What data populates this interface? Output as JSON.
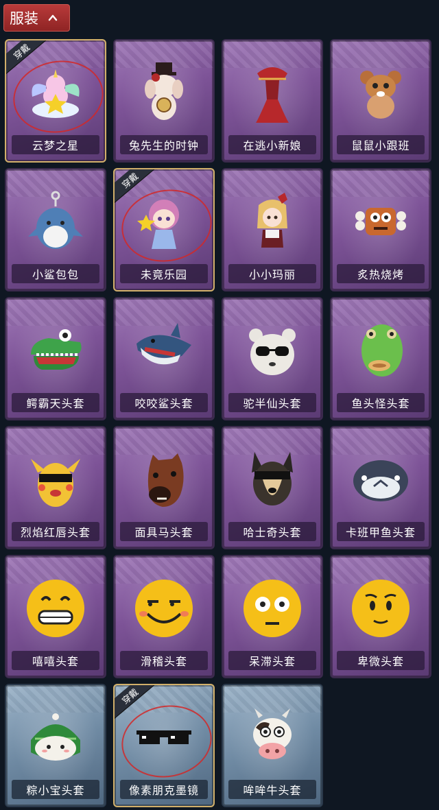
{
  "header": {
    "title": "服装"
  },
  "worn_label": "穿戴",
  "items": [
    {
      "label": "云梦之星",
      "worn": true,
      "bg": "purple",
      "icon": "unicorn-star-icon"
    },
    {
      "label": "兔先生的时钟",
      "worn": false,
      "bg": "purple",
      "icon": "rabbit-clock-icon"
    },
    {
      "label": "在逃小新娘",
      "worn": false,
      "bg": "purple",
      "icon": "bride-dress-icon"
    },
    {
      "label": "鼠鼠小跟班",
      "worn": false,
      "bg": "purple",
      "icon": "mouse-follower-icon"
    },
    {
      "label": "小鲨包包",
      "worn": false,
      "bg": "purple",
      "icon": "shark-bag-icon"
    },
    {
      "label": "未竟乐园",
      "worn": true,
      "bg": "purple",
      "icon": "fairy-girl-icon"
    },
    {
      "label": "小小玛丽",
      "worn": false,
      "bg": "purple",
      "icon": "mary-doll-icon"
    },
    {
      "label": "炙热烧烤",
      "worn": false,
      "bg": "purple",
      "icon": "bbq-meat-icon"
    },
    {
      "label": "鳄霸天头套",
      "worn": false,
      "bg": "purple",
      "icon": "crocodile-head-icon"
    },
    {
      "label": "咬咬鲨头套",
      "worn": false,
      "bg": "purple",
      "icon": "shark-head-icon"
    },
    {
      "label": "驼半仙头套",
      "worn": false,
      "bg": "purple",
      "icon": "panda-head-icon"
    },
    {
      "label": "鱼头怪头套",
      "worn": false,
      "bg": "purple",
      "icon": "fish-head-icon"
    },
    {
      "label": "烈焰红唇头套",
      "worn": false,
      "bg": "purple",
      "icon": "yellow-mascot-head-icon"
    },
    {
      "label": "面具马头套",
      "worn": false,
      "bg": "purple",
      "icon": "horse-head-icon"
    },
    {
      "label": "哈士奇头套",
      "worn": false,
      "bg": "purple",
      "icon": "husky-head-icon"
    },
    {
      "label": "卡班甲鱼头套",
      "worn": false,
      "bg": "purple",
      "icon": "whale-head-icon"
    },
    {
      "label": "嘻嘻头套",
      "worn": false,
      "bg": "purple",
      "icon": "grin-emoji-icon"
    },
    {
      "label": "滑稽头套",
      "worn": false,
      "bg": "purple",
      "icon": "funny-emoji-icon"
    },
    {
      "label": "呆滞头套",
      "worn": false,
      "bg": "purple",
      "icon": "dazed-emoji-icon"
    },
    {
      "label": "卑微头套",
      "worn": false,
      "bg": "purple",
      "icon": "humble-emoji-icon"
    },
    {
      "label": "粽小宝头套",
      "worn": false,
      "bg": "blue",
      "icon": "zongzi-head-icon"
    },
    {
      "label": "像素朋克墨镜",
      "worn": true,
      "bg": "blue",
      "icon": "pixel-sunglasses-icon"
    },
    {
      "label": "哞哞牛头套",
      "worn": false,
      "bg": "blue",
      "icon": "cow-head-icon"
    }
  ]
}
